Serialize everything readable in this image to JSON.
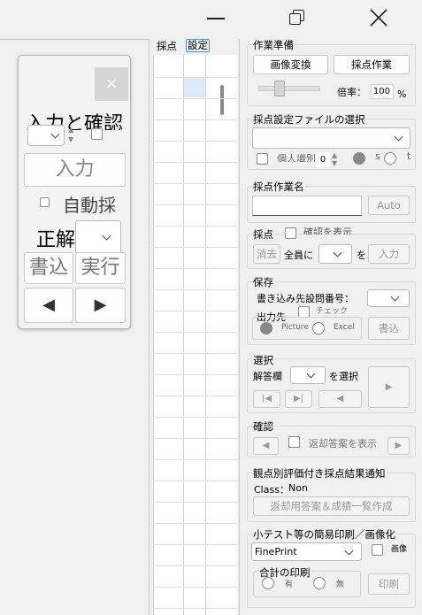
{
  "titlebar": {
    "minimize_icon": "minimize-icon",
    "restore_icon": "restore-icon",
    "close_icon": "close-icon"
  },
  "float": {
    "input_check_label": "入力と確認",
    "input_button": "入力",
    "auto_label": "自動採",
    "correct_label": "正解",
    "write_button": "書込",
    "run_button": "実行",
    "prev_button": "◀",
    "next_button": "▶"
  },
  "grid": {
    "tab_score": "採点",
    "tab_settings": "設定"
  },
  "panel": {
    "prep": {
      "title": "作業準備",
      "convert_button": "画像変換",
      "score_button": "採点作業",
      "zoom_label": "倍率：",
      "zoom_value": "100",
      "zoom_unit": "%"
    },
    "file": {
      "title": "採点設定ファイルの選択",
      "individual_label": "個人識別",
      "spin_value": "0",
      "opt_s": "s",
      "opt_t": "t"
    },
    "name": {
      "title": "採点作業名",
      "auto_button": "Auto"
    },
    "scoring": {
      "title": "採点",
      "confirm_label": "確認を表示",
      "erase_button": "消去",
      "all_label": "全員に",
      "wo_label": "を",
      "input_button": "入力"
    },
    "save": {
      "title": "保存",
      "dest_q_label": "書き込み先設問番号：",
      "output_label": "出力先",
      "check_label": "チェック",
      "picture_label": "Picture",
      "excel_label": "Excel",
      "write_button": "書込"
    },
    "select": {
      "title": "選択",
      "answer_label": "解答欄",
      "select_label": "を選択",
      "first_button": "|◀",
      "last_button": "▶|",
      "prev_button": "◀",
      "next_button": "▶"
    },
    "confirm": {
      "title": "確認",
      "prev_button": "◀",
      "return_label": "返却答案を表示",
      "next_button": "▶"
    },
    "notice": {
      "title": "観点別評価付き採点結果通知",
      "class_label": "Class：",
      "class_value": "Non",
      "create_button": "返却用答案＆成績一覧作成"
    },
    "print": {
      "title": "小テスト等の簡易印刷／画像化",
      "printer_value": "FinePrint",
      "image_label": "画像",
      "total_title": "合計の印刷",
      "yes_label": "有",
      "no_label": "無",
      "print_button": "印刷"
    }
  }
}
